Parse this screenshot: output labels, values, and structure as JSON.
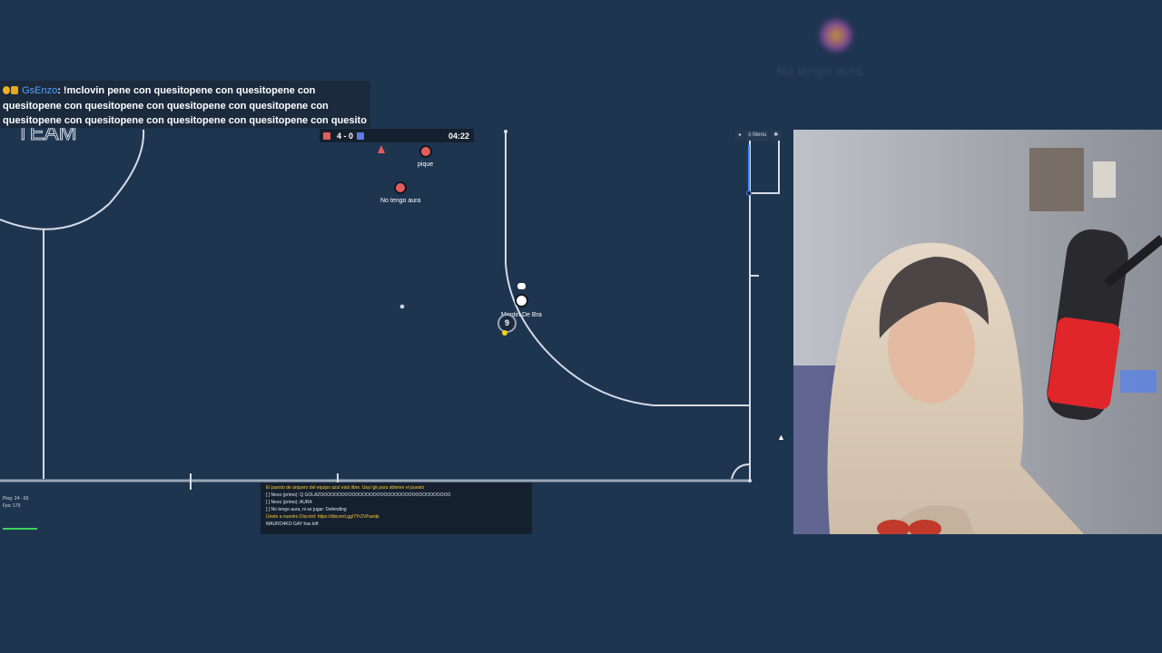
{
  "chat_overlay": {
    "username": "GsEnzo",
    "message": ": !mclovin pene con quesitopene con quesitopene con quesitopene con quesitopene con quesitopene con quesitopene con quesitopene con quesitopene con quesitopene con quesitopene con quesito"
  },
  "scoreboard": {
    "score": "4 - 0",
    "time": "04:22"
  },
  "toolbar": {
    "sound_icon": "speaker-icon",
    "menu_label": "≡ Menu",
    "settings_icon": "gear-icon"
  },
  "players": {
    "pique": "pique",
    "no_tengo_aura": "No tengo aura",
    "self": "Mentin De Bra",
    "self_number": "9"
  },
  "team_label": "TEAM",
  "stream_ghost_name": "No tengo aura",
  "ping_panel": {
    "ping": "Ping: 24 - 65",
    "fps": "Fps: 179"
  },
  "game_chat": {
    "lines": [
      "El puesto de arquero del equipo azul está libre. Usa !gk para obtener el puesto",
      "[ ] Nexo (primo): Q GOLAZOOOOOOOOOOOOOOOOOOOOOOOOOOOOOOOOOOOOO",
      "[ ] Nexo (primo): AURA",
      "[ ] No tengo aura, ni se jugar: Defending",
      "Únete a nuestro Discord: https://discord.gg/7YrZVFuedp",
      "MAURO4KO GAY has left"
    ]
  },
  "colors": {
    "background": "#1e3550",
    "red_team": "#e35d5b",
    "blue_team": "#5a7ddd"
  }
}
